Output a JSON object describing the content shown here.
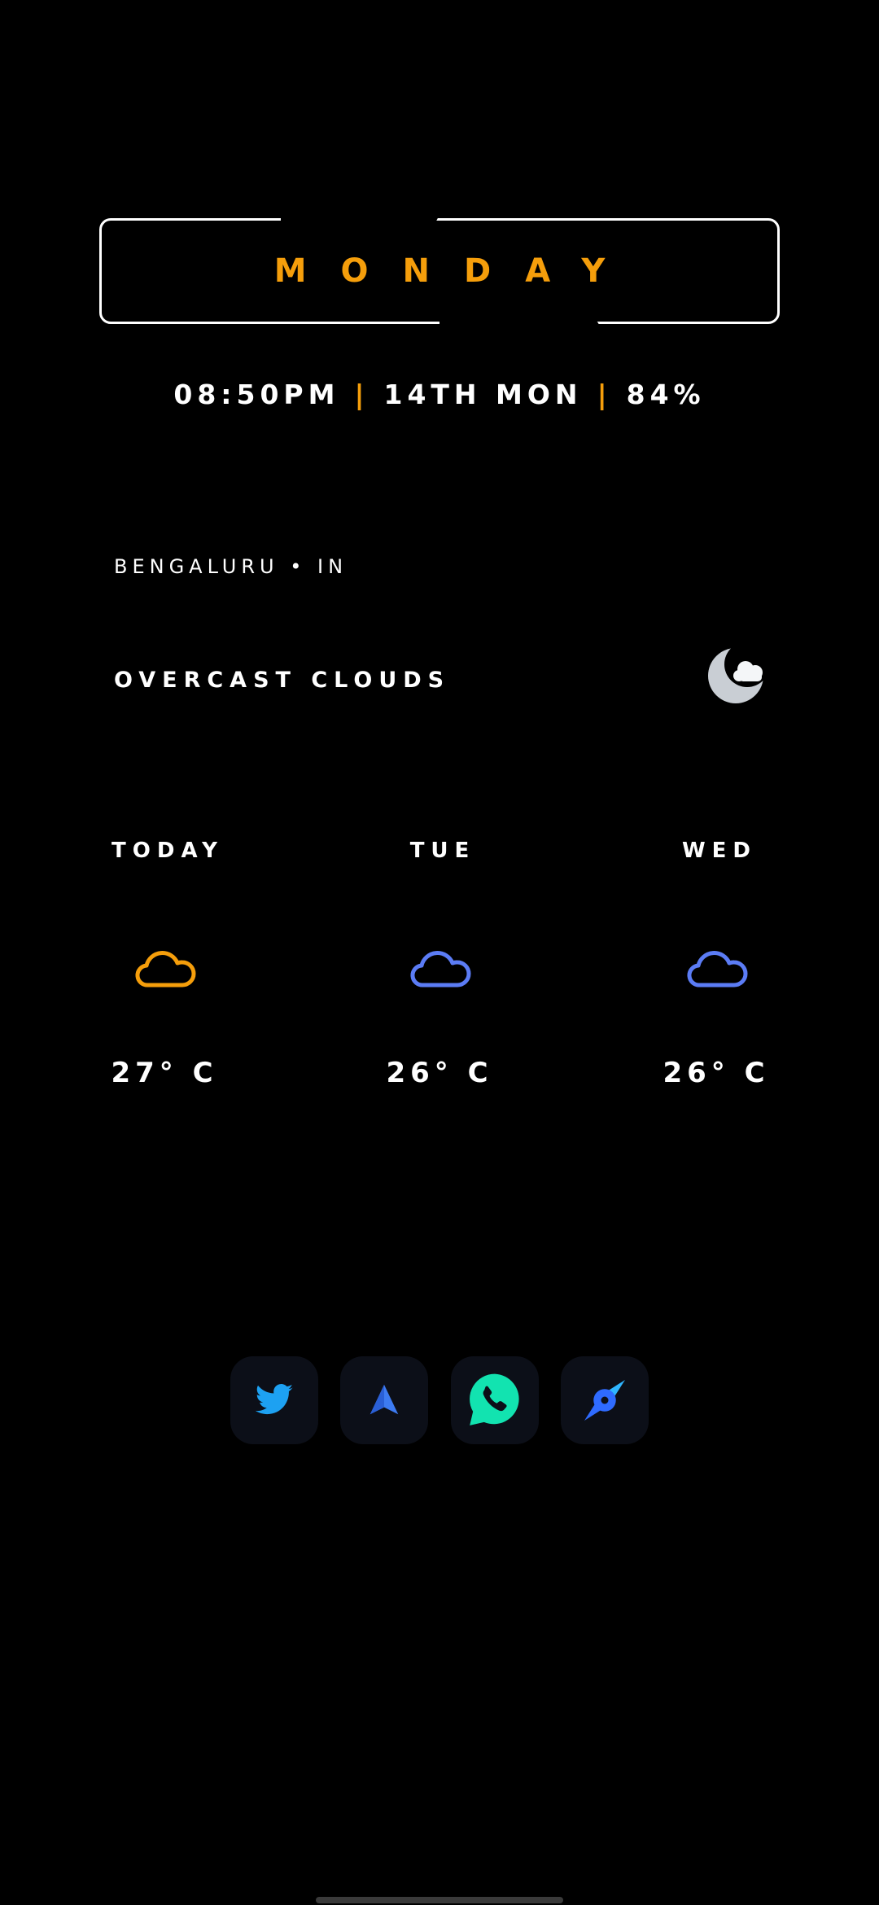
{
  "clock_widget": {
    "day": "MONDAY",
    "time": "08:50PM",
    "date": "14TH MON",
    "battery": "84%",
    "separator": "|"
  },
  "weather": {
    "location": "BENGALURU • IN",
    "condition": "OVERCAST CLOUDS",
    "condition_icon": "moon-cloud-icon",
    "forecast": [
      {
        "day": "TODAY",
        "temp": "27° C",
        "icon": "cloud-icon",
        "color": "#f59e0b"
      },
      {
        "day": "TUE",
        "temp": "26° C",
        "icon": "cloud-icon",
        "color": "#5b7cf5"
      },
      {
        "day": "WED",
        "temp": "26° C",
        "icon": "cloud-icon",
        "color": "#5b7cf5"
      }
    ]
  },
  "dock": {
    "apps": [
      {
        "name": "Twitter",
        "icon": "twitter-bird-icon",
        "color": "#1da1f2"
      },
      {
        "name": "Navigation",
        "icon": "navigation-arrow-icon",
        "color": "#3d7bf2"
      },
      {
        "name": "WhatsApp",
        "icon": "phone-chat-icon",
        "color": "#12e3b0"
      },
      {
        "name": "Browser",
        "icon": "compass-icon",
        "color": "#2f6bff"
      }
    ]
  },
  "colors": {
    "accent": "#f59e0b",
    "background": "#000000",
    "text": "#ffffff"
  }
}
